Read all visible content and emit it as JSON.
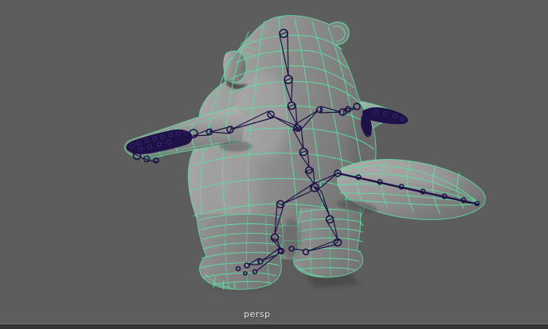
{
  "viewport": {
    "camera_label": "persp"
  },
  "scene": {
    "content": "character mesh with wireframe and joint skeleton",
    "shading_mode": "smooth-shaded-with-wireframe"
  },
  "colors": {
    "background": "#5d5d5d",
    "wireframe": "#5ce0a2",
    "skeleton": "#1d1148",
    "mesh_light": "#b2b2b2",
    "mesh_mid": "#949494",
    "mesh_dark": "#747474",
    "ground_shadow": "#474747",
    "camera_label_color": "#e6e6e6",
    "bottom_bar": "#343434",
    "bottom_bar_highlight": "#747474"
  }
}
